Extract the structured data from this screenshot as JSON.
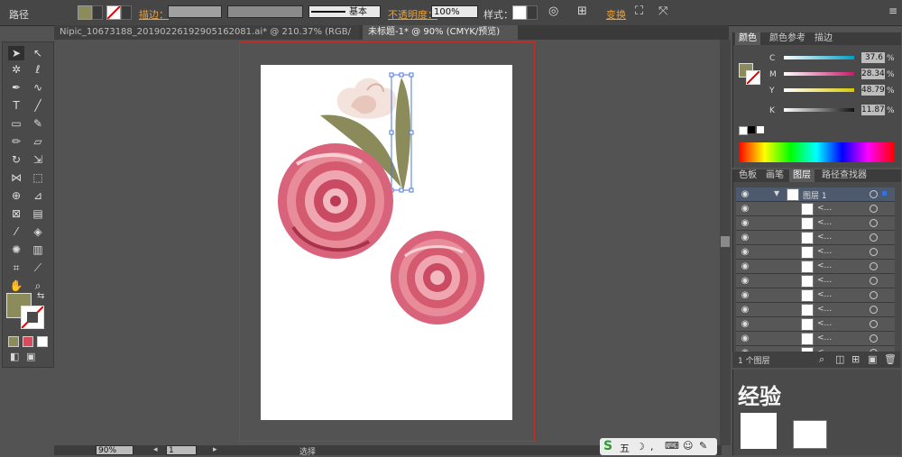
{
  "control_bar": {
    "object_type": "路径",
    "stroke_label": "描边：",
    "stroke_style": "基本",
    "opacity_label": "不透明度：",
    "opacity_value": "100%",
    "style_label": "样式：",
    "transform_label": "变换",
    "fill_color": "#8b8b5c"
  },
  "document_tabs": [
    {
      "label": "Nipic_10673188_20190226192905162081.ai* @ 210.37% (RGB/预览)"
    },
    {
      "label": "未标题-1* @ 90% (CMYK/预览)"
    }
  ],
  "color_panel": {
    "tabs": [
      "颜色",
      "颜色参考",
      "描边"
    ],
    "channels": [
      {
        "name": "C",
        "value": "37.6",
        "unit": "%",
        "gradient": [
          "#ffffff",
          "#00a0c6"
        ]
      },
      {
        "name": "M",
        "value": "28.34",
        "unit": "%",
        "gradient": [
          "#ffffff",
          "#c61a6b"
        ]
      },
      {
        "name": "Y",
        "value": "48.79",
        "unit": "%",
        "gradient": [
          "#ffffff",
          "#d9c800"
        ]
      },
      {
        "name": "K",
        "value": "11.87",
        "unit": "%",
        "gradient": [
          "#ffffff",
          "#111111"
        ]
      }
    ]
  },
  "layers_panel": {
    "tabs": [
      "色板",
      "画笔",
      "图层",
      "路径查找器"
    ],
    "layer_name": "图层 1",
    "sublayer_label": "<...",
    "footer": "1 个图层",
    "row_count": 11
  },
  "status_bar": {
    "zoom": "90%",
    "page": "1",
    "tool_status": "选择"
  },
  "overlay": {
    "watermark": "经验",
    "ime_label": "五"
  }
}
